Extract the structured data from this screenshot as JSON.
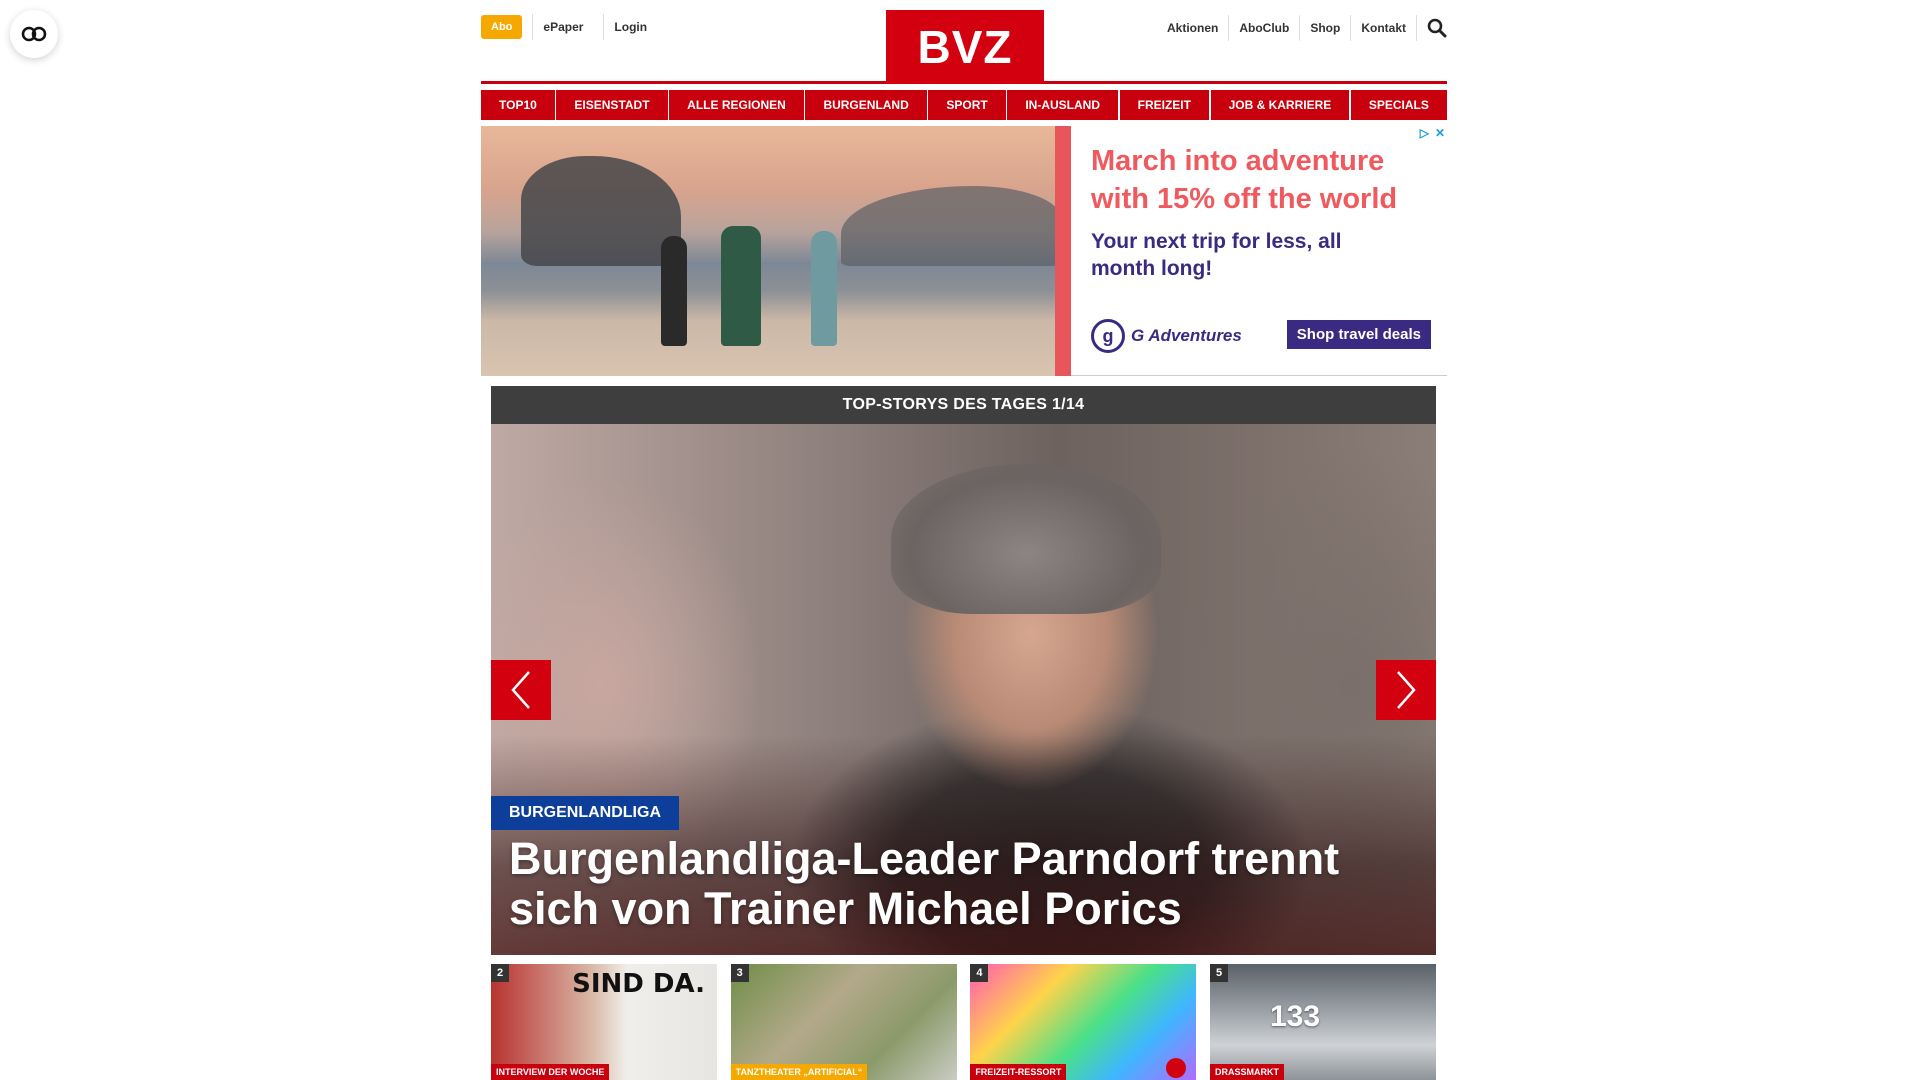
{
  "header": {
    "abo": "Abo",
    "left_links": [
      "ePaper",
      "Login"
    ],
    "logo": "BVZ",
    "right_links": [
      "Aktionen",
      "AboClub",
      "Shop",
      "Kontakt"
    ]
  },
  "nav": [
    "TOP10",
    "EISENSTADT",
    "ALLE REGIONEN",
    "BURGENLAND",
    "SPORT",
    "IN-AUSLAND",
    "FREIZEIT",
    "JOB & KARRIERE",
    "SPECIALS"
  ],
  "ad": {
    "headline": "March into adventure with 15% off the world",
    "subline": "Your next trip for less, all month long!",
    "brand": "G Adventures",
    "cta": "Shop travel deals"
  },
  "stories": {
    "heading": "TOP-STORYS DES TAGES 1/14",
    "hero_tag": "BURGENLANDLIGA",
    "hero_title": "Burgenlandliga-Leader Parndorf trennt sich von Trainer Michael Porics"
  },
  "teasers": [
    {
      "num": "2",
      "tag": "INTERVIEW DER WOCHE",
      "sign": "SIND DA."
    },
    {
      "num": "3",
      "tag": "TANZTHEATER „ARTIFICIAL“"
    },
    {
      "num": "4",
      "tag": "FREIZEIT-RESSORT"
    },
    {
      "num": "5",
      "tag": "DRASSMARKT",
      "plate": "133"
    }
  ],
  "colors": {
    "brand_red": "#c8000e",
    "abo_yellow": "#f5a800",
    "tag_blue": "#0d3f9a",
    "ad_coral": "#ef5a5f",
    "ad_purple": "#3b2a82"
  }
}
